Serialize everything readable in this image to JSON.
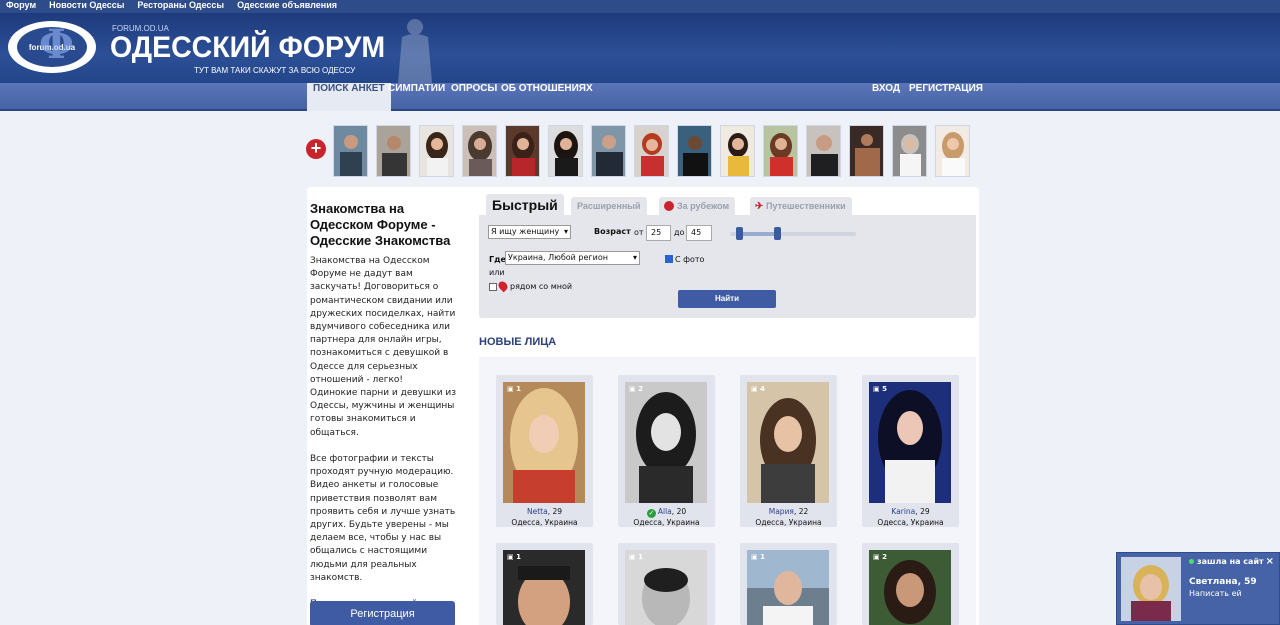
{
  "topbar": {
    "links": [
      "Форум",
      "Новости Одессы",
      "Рестораны Одессы",
      "Одесские объявления"
    ]
  },
  "header": {
    "logo_text": "forum.od.ua",
    "site_url": "FORUM.OD.UA",
    "title": "ОДЕССКИЙ ФОРУМ",
    "slogan": "ТУТ ВАМ ТАКИ СКАЖУТ ЗА ВСЮ ОДЕССУ"
  },
  "nav": {
    "items": [
      "ПОИСК АНКЕТ",
      "СИМПАТИИ",
      "ОПРОСЫ",
      "ОБ ОТНОШЕНИЯХ"
    ],
    "login": "ВХОД",
    "register": "РЕГИСТРАЦИЯ"
  },
  "strip": {
    "add_icon": "plus-icon"
  },
  "sidebar": {
    "title": "Знакомства на Одесском Форуме - Одесские Знакомства",
    "text": "Знакомства на Одесском Форуме не дадут вам заскучать! Договориться о романтическом свидании или дружеских посиделках, найти вдумчивого собеседника или партнера для онлайн игры, познакомиться с девушкой в Одессе для серьезных отношений - легко!\nОдинокие парни и девушки из Одессы, мужчины и женщины готовы знакомиться и общаться.\n\nВсе фотографии и тексты проходят ручную модерацию. Видео анкеты и голосовые приветствия позволят вам проявить себя и лучше узнать других. Будьте уверены - мы делаем все, чтобы у нас вы общались с настоящими людьми для реальных знакомств.\n\nПросто зарегистрируйтесь и общайтесь!",
    "register_button": "Регистрация"
  },
  "search": {
    "tabs": [
      "Быстрый",
      "Расширенный",
      "За рубежом",
      "Путешественники"
    ],
    "seeking": "Я ищу женщину",
    "age_label": "Возраст",
    "from_label": "от",
    "age_from": "25",
    "to_label": "до",
    "age_to": "45",
    "age_slider_from_fraction": 0.05,
    "age_slider_to_fraction": 0.35,
    "where_label": "Где",
    "location": "Украина, Любой регион",
    "with_photo_label": "С фото",
    "with_photo_checked": true,
    "or_label": "или",
    "near_me_label": "рядом со мной",
    "near_me_checked": false,
    "find_button": "Найти"
  },
  "new_faces": {
    "title": "НОВЫЕ ЛИЦА",
    "profiles": [
      {
        "count": "1",
        "name": "Netta",
        "age": "29",
        "city": "Одесса, Украина",
        "verified": false
      },
      {
        "count": "2",
        "name": "Alla",
        "age": "20",
        "city": "Одесса, Украина",
        "verified": true
      },
      {
        "count": "4",
        "name": "Мария",
        "age": "22",
        "city": "Одесса, Украина",
        "verified": false
      },
      {
        "count": "5",
        "name": "Karina",
        "age": "29",
        "city": "Одесса, Украина",
        "verified": false
      },
      {
        "count": "1"
      },
      {
        "count": "1"
      },
      {
        "count": "1"
      },
      {
        "count": "2"
      }
    ]
  },
  "popup": {
    "status": "зашла на сайт",
    "name": "Светлана, 59",
    "action": "Написать ей",
    "close": "×"
  },
  "colors": {
    "brand": "#2e4c8a",
    "accent": "#3f5ba3",
    "alert": "#c9242b"
  }
}
